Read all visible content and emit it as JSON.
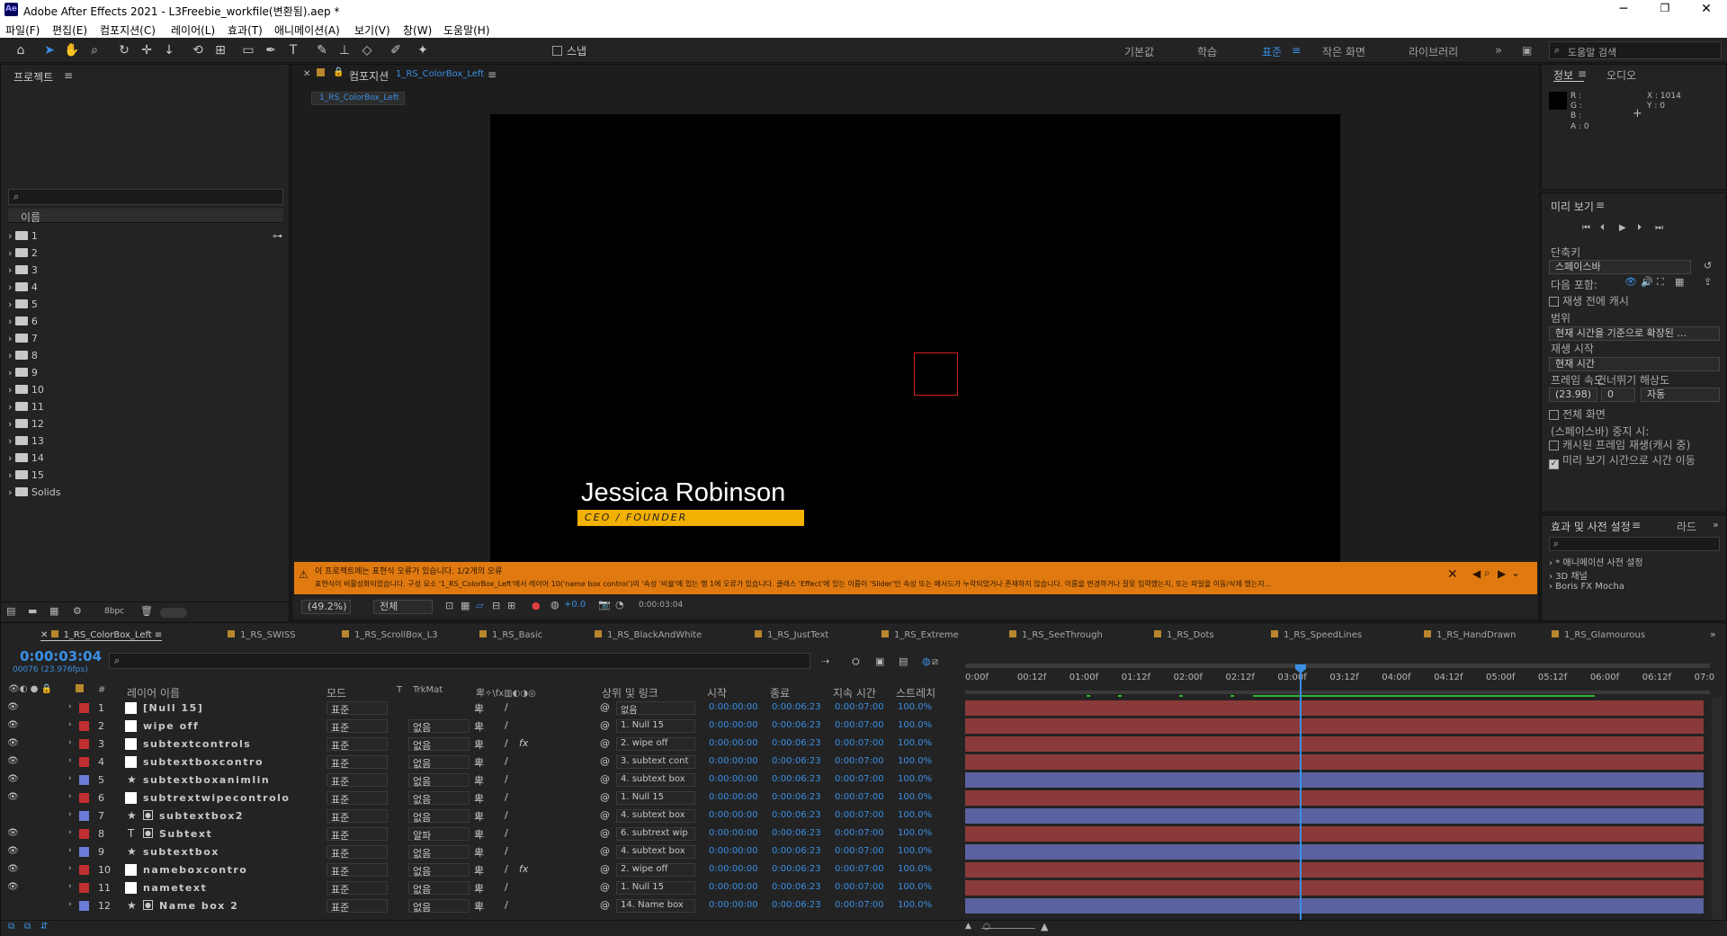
{
  "app": {
    "logo": "Ae",
    "title": "Adobe After Effects 2021 - L3Freebie_workfile(변환됨).aep *"
  },
  "menu": [
    "파일(F)",
    "편집(E)",
    "컴포지션(C)",
    "레이어(L)",
    "효과(T)",
    "애니메이션(A)",
    "보기(V)",
    "창(W)",
    "도움말(H)"
  ],
  "toolbar": {
    "snap": "스냅",
    "workspaces": [
      "기본값",
      "학습",
      "표준",
      "작은 화면",
      "라이브러리"
    ],
    "active_ws": "표준",
    "search": "도움말 검색"
  },
  "project": {
    "title": "프로젝트",
    "col_name": "이름",
    "items": [
      "1",
      "2",
      "3",
      "4",
      "5",
      "6",
      "7",
      "8",
      "9",
      "10",
      "11",
      "12",
      "13",
      "14",
      "15",
      "Solids"
    ],
    "bpc": "8bpc"
  },
  "comp": {
    "title": "컴포지션",
    "comp_name": "1_RS_ColorBox_Left",
    "tab": "1_RS_ColorBox_Left",
    "lower_third_name": "Jessica Robinson",
    "lower_third_title": "CEO / FOUNDER",
    "warning_title": "이 프로젝트에는 표현식 오류가 있습니다. 1/2개의 오류",
    "warning_text": "표현식이 비활성화되었습니다. 구성 요소 '1_RS_ColorBox_Left'에서 레이어 10('name box control')의 '속성 '비율'에 있는 행 1에 오류가 있습니다. 클래스 'Effect'에 있는 이름이 'Slider'인 속성 또는 메서드가 누락되었거나 존재하지 않습니다. 이름을 변경하거나 잘못 입력했는지, 또는 파일을 이동/삭제 했는지...",
    "zoom": "(49.2%)",
    "res": "전체",
    "exposure": "+0.0",
    "time": "0:00:03:04"
  },
  "info": {
    "tab1": "정보",
    "tab2": "오디오",
    "r": "R :",
    "g": "G :",
    "b": "B :",
    "a": "A : 0",
    "x": "X : 1014",
    "y": "Y : 0"
  },
  "preview": {
    "title": "미리 보기",
    "shortcut_label": "단축키",
    "shortcut": "스페이스바",
    "include_label": "다음 포함:",
    "cache_before": "재생 전에 캐시",
    "range_label": "범위",
    "range": "현재 시간을 기준으로 확장된 ...",
    "play_from_label": "재생 시작",
    "play_from": "현재 시간",
    "fps_label": "프레임 속도",
    "skip_label": "건너뛰기",
    "res_label": "해상도",
    "fps": "(23.98)",
    "skip": "0",
    "res": "자동",
    "fullscreen": "전체 화면",
    "on_stop": "(스페이스바) 중지 시:",
    "cached_frames": "캐시된 프레임 재생(캐시 중)",
    "move_time": "미리 보기 시간으로 시간 이동"
  },
  "effects": {
    "title": "효과 및 사전 설정",
    "tab2": "라드",
    "items": [
      "* 애니메이션 사전 설정",
      "3D 채널",
      "Boris FX Mocha"
    ]
  },
  "timeline": {
    "tabs": [
      "1_RS_ColorBox_Left",
      "1_RS_SWISS",
      "1_RS_ScrollBox_L3",
      "1_RS_Basic",
      "1_RS_BlackAndWhite",
      "1_RS_JustText",
      "1_RS_Extreme",
      "1_RS_SeeThrough",
      "1_RS_Dots",
      "1_RS_SpeedLines",
      "1_RS_HandDrawn",
      "1_RS_Glamourous"
    ],
    "timecode": "0:00:03:04",
    "fps": "00076 (23.976fps)",
    "headers": {
      "name": "레이어 이름",
      "mode": "모드",
      "t": "T",
      "trkmat": "TrkMat",
      "parent": "상위 및 링크",
      "in": "시작",
      "out": "종료",
      "dur": "지속 시간",
      "stretch": "스트레치",
      "hash": "#"
    },
    "ruler": [
      "0:00f",
      "00:12f",
      "01:00f",
      "01:12f",
      "02:00f",
      "02:12f",
      "03:00f",
      "03:12f",
      "04:00f",
      "04:12f",
      "05:00f",
      "05:12f",
      "06:00f",
      "06:12f",
      "07:0"
    ],
    "layers": [
      {
        "n": "1",
        "name": "[Null 15]",
        "mode": "표준",
        "trk": "",
        "parent": "없음",
        "in": "0:00:00:00",
        "out": "0:00:06:23",
        "dur": "0:00:07:00",
        "st": "100.0%",
        "color": "#c03030",
        "bar": "#8b3a3a",
        "icon": "box",
        "fx": false
      },
      {
        "n": "2",
        "name": "wipe off",
        "mode": "표준",
        "trk": "없음",
        "parent": "1. Null 15",
        "in": "0:00:00:00",
        "out": "0:00:06:23",
        "dur": "0:00:07:00",
        "st": "100.0%",
        "color": "#c03030",
        "bar": "#8b3a3a",
        "icon": "box",
        "fx": false
      },
      {
        "n": "3",
        "name": "subtextcontrols",
        "mode": "표준",
        "trk": "없음",
        "parent": "2. wipe off",
        "in": "0:00:00:00",
        "out": "0:00:06:23",
        "dur": "0:00:07:00",
        "st": "100.0%",
        "color": "#c03030",
        "bar": "#8b3a3a",
        "icon": "box",
        "fx": true
      },
      {
        "n": "4",
        "name": "subtextboxcontro",
        "mode": "표준",
        "trk": "없음",
        "parent": "3. subtext cont",
        "in": "0:00:00:00",
        "out": "0:00:06:23",
        "dur": "0:00:07:00",
        "st": "100.0%",
        "color": "#c03030",
        "bar": "#8b3a3a",
        "icon": "box",
        "fx": false
      },
      {
        "n": "5",
        "name": "subtextboxanimlin",
        "mode": "표준",
        "trk": "없음",
        "parent": "4. subtext box",
        "in": "0:00:00:00",
        "out": "0:00:06:23",
        "dur": "0:00:07:00",
        "st": "100.0%",
        "color": "#6b7bd8",
        "bar": "#5a62a0",
        "icon": "star",
        "fx": false
      },
      {
        "n": "6",
        "name": "subtrextwipecontrolo",
        "mode": "표준",
        "trk": "없음",
        "parent": "1. Null 15",
        "in": "0:00:00:00",
        "out": "0:00:06:23",
        "dur": "0:00:07:00",
        "st": "100.0%",
        "color": "#c03030",
        "bar": "#8b3a3a",
        "icon": "box",
        "fx": false
      },
      {
        "n": "7",
        "name": "subtextbox2",
        "mode": "표준",
        "trk": "없음",
        "parent": "4. subtext box",
        "in": "0:00:00:00",
        "out": "0:00:06:23",
        "dur": "0:00:07:00",
        "st": "100.0%",
        "color": "#6b7bd8",
        "bar": "#5a62a0",
        "icon": "star",
        "fx": false
      },
      {
        "n": "8",
        "name": "Subtext",
        "mode": "표준",
        "trk": "알파",
        "parent": "6. subtrext wip",
        "in": "0:00:00:00",
        "out": "0:00:06:23",
        "dur": "0:00:07:00",
        "st": "100.0%",
        "color": "#c03030",
        "bar": "#8b3a3a",
        "icon": "T",
        "fx": false
      },
      {
        "n": "9",
        "name": "subtextbox",
        "mode": "표준",
        "trk": "없음",
        "parent": "4. subtext box",
        "in": "0:00:00:00",
        "out": "0:00:06:23",
        "dur": "0:00:07:00",
        "st": "100.0%",
        "color": "#6b7bd8",
        "bar": "#5a62a0",
        "icon": "star",
        "fx": false
      },
      {
        "n": "10",
        "name": "nameboxcontro",
        "mode": "표준",
        "trk": "없음",
        "parent": "2. wipe off",
        "in": "0:00:00:00",
        "out": "0:00:06:23",
        "dur": "0:00:07:00",
        "st": "100.0%",
        "color": "#c03030",
        "bar": "#8b3a3a",
        "icon": "box",
        "fx": true
      },
      {
        "n": "11",
        "name": "nametext",
        "mode": "표준",
        "trk": "없음",
        "parent": "1. Null 15",
        "in": "0:00:00:00",
        "out": "0:00:06:23",
        "dur": "0:00:07:00",
        "st": "100.0%",
        "color": "#c03030",
        "bar": "#8b3a3a",
        "icon": "box",
        "fx": false
      },
      {
        "n": "12",
        "name": "Name box 2",
        "mode": "표준",
        "trk": "없음",
        "parent": "14. Name box",
        "in": "0:00:00:00",
        "out": "0:00:06:23",
        "dur": "0:00:07:00",
        "st": "100.0%",
        "color": "#6b7bd8",
        "bar": "#5a62a0",
        "icon": "star",
        "fx": false
      }
    ]
  }
}
